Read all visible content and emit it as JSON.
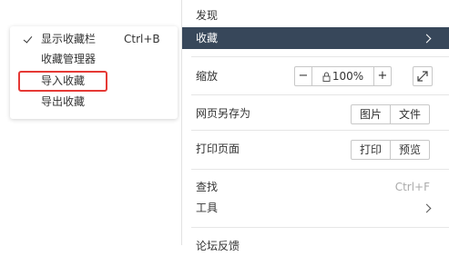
{
  "main_menu": {
    "discover": "发现",
    "favorites": "收藏",
    "zoom": {
      "label": "缩放",
      "minus": "−",
      "value": "100%",
      "plus": "+"
    },
    "save_page": {
      "label": "网页另存为",
      "image": "图片",
      "file": "文件"
    },
    "print_page": {
      "label": "打印页面",
      "print": "打印",
      "preview": "预览"
    },
    "find": {
      "label": "查找",
      "shortcut": "Ctrl+F"
    },
    "tools": "工具",
    "feedback": "论坛反馈"
  },
  "submenu": {
    "items": [
      {
        "label": "显示收藏栏",
        "shortcut": "Ctrl+B",
        "checked": true
      },
      {
        "label": "收藏管理器"
      },
      {
        "label": "导入收藏",
        "highlighted": true
      },
      {
        "label": "导出收藏"
      }
    ]
  },
  "colors": {
    "selected_bg": "#37475a",
    "highlight_border": "#e53935"
  }
}
